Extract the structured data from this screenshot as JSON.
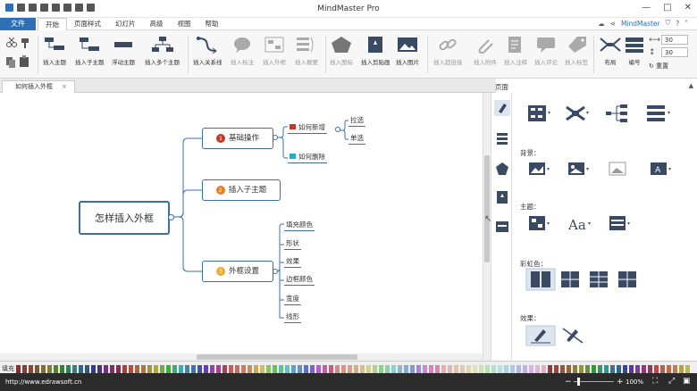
{
  "app": {
    "title": "MindMaster Pro"
  },
  "menu": {
    "file_label": "文件",
    "tabs": [
      "开始",
      "页面样式",
      "幻灯片",
      "高级",
      "视图",
      "帮助"
    ],
    "active_tab": "开始",
    "account_label": "MindMaster"
  },
  "ribbon": {
    "items": [
      {
        "label": "插入主题",
        "name": "insert-topic",
        "enabled": true
      },
      {
        "label": "插入子主题",
        "name": "insert-subtopic",
        "enabled": true
      },
      {
        "label": "浮动主题",
        "name": "floating-topic",
        "enabled": true
      },
      {
        "label": "插入多个主题",
        "name": "insert-multiple-topics",
        "enabled": true
      },
      {
        "label": "插入关系线",
        "name": "insert-relationship",
        "enabled": true
      },
      {
        "label": "插入标注",
        "name": "insert-callout",
        "enabled": false
      },
      {
        "label": "插入外框",
        "name": "insert-boundary",
        "enabled": false
      },
      {
        "label": "插入概要",
        "name": "insert-summary",
        "enabled": false
      },
      {
        "label": "插入图标",
        "name": "insert-icon",
        "enabled": false
      },
      {
        "label": "插入剪贴画",
        "name": "insert-clipart",
        "enabled": true
      },
      {
        "label": "插入图片",
        "name": "insert-picture",
        "enabled": true
      },
      {
        "label": "插入超链接",
        "name": "insert-hyperlink",
        "enabled": false
      },
      {
        "label": "插入附件",
        "name": "insert-attachment",
        "enabled": false
      },
      {
        "label": "插入注释",
        "name": "insert-note",
        "enabled": false
      },
      {
        "label": "插入评论",
        "name": "insert-comment",
        "enabled": false
      },
      {
        "label": "插入标签",
        "name": "insert-tag",
        "enabled": false
      },
      {
        "label": "布局",
        "name": "layout",
        "enabled": true
      },
      {
        "label": "编号",
        "name": "numbering",
        "enabled": true
      }
    ],
    "spin1": "30",
    "spin2": "30",
    "reset_label": "重置"
  },
  "doc_tab": {
    "label": "如何插入外框"
  },
  "mindmap": {
    "root": "怎样插入外框",
    "branches": [
      {
        "num": "1",
        "label": "基础操作",
        "color": "#c0392b"
      },
      {
        "num": "2",
        "label": "插入子主题",
        "color": "#e67e22"
      },
      {
        "num": "3",
        "label": "外框设置",
        "color": "#f0a830"
      }
    ],
    "b1_children": [
      "如何新增",
      "如何删除"
    ],
    "b1_grandchildren": [
      "拉选",
      "单选"
    ],
    "b3_children": [
      "填充颜色",
      "形状",
      "效果",
      "边框颜色",
      "宽度",
      "线形"
    ]
  },
  "panel": {
    "title": "页面",
    "background_label": "背景：",
    "theme_label": "主题：",
    "rainbow_label": "彩虹色：",
    "effect_label": "效果："
  },
  "palette": {
    "label": "填充"
  },
  "status": {
    "url": "http://www.edrawsoft.cn",
    "zoom": "100%"
  },
  "colors": {
    "accent": "#2e6fb6",
    "status_bar": "#2b2b2b",
    "node_border": "#3d6fa6"
  }
}
